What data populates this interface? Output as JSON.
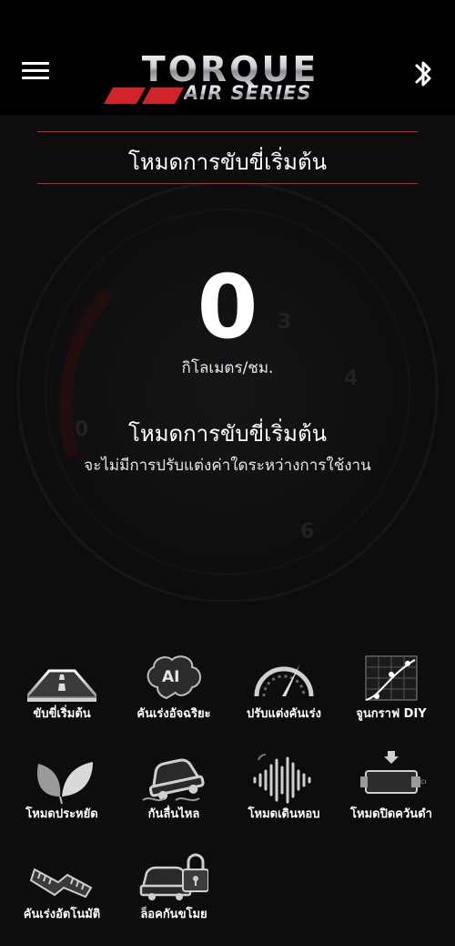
{
  "header": {
    "logo_main": "TORQUE",
    "logo_sub": "AIR SERIES",
    "menu_icon": "hamburger-menu-icon",
    "bluetooth_icon": "bluetooth-icon"
  },
  "title_bar": {
    "title": "โหมดการขับขี่เริ่มต้น"
  },
  "speed": {
    "value": "0",
    "unit": "กิโลเมตร/ชม."
  },
  "mode": {
    "title": "โหมดการขับขี่เริ่มต้น",
    "description": "จะไม่มีการปรับแต่งค่าใดระหว่างการใช้งาน"
  },
  "background_gauge_ticks": [
    "0",
    "3",
    "4",
    "6"
  ],
  "modes": [
    {
      "label": "ขับขี่เริ่มต้น",
      "icon": "road-icon"
    },
    {
      "label": "คันเร่งอัจฉริยะ",
      "icon": "ai-brain-icon"
    },
    {
      "label": "ปรับแต่งคันเร่ง",
      "icon": "speedometer-icon"
    },
    {
      "label": "จูนกราฟ DIY",
      "icon": "graph-icon"
    },
    {
      "label": "โหมดประหยัด",
      "icon": "leaf-icon"
    },
    {
      "label": "กันลื่นไหล",
      "icon": "skid-car-icon"
    },
    {
      "label": "โหมดเดินหอบ",
      "icon": "waveform-icon"
    },
    {
      "label": "โหมดปิดควันดำ",
      "icon": "exhaust-icon"
    },
    {
      "label": "คันเร่งอัตโนมัติ",
      "icon": "pedal-icon"
    },
    {
      "label": "ล็อคกันขโมย",
      "icon": "car-lock-icon"
    }
  ],
  "colors": {
    "accent_red": "#c7262b",
    "background": "#0d0d0e",
    "header": "#000000"
  }
}
